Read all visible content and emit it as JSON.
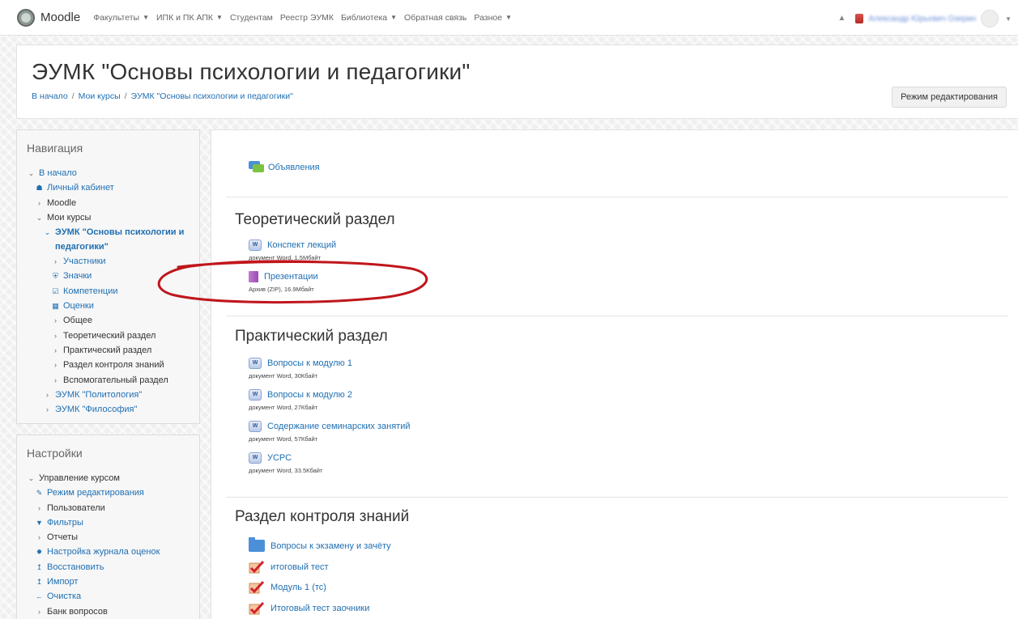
{
  "navbar": {
    "brand": "Moodle",
    "menu": [
      {
        "label": "Факультеты",
        "caret": true
      },
      {
        "label": "ИПК и ПК АПК",
        "caret": true
      },
      {
        "label": "Студентам",
        "caret": false
      },
      {
        "label": "Реестр ЭУМК",
        "caret": false
      },
      {
        "label": "Библиотека",
        "caret": true
      },
      {
        "label": "Обратная связь",
        "caret": false
      },
      {
        "label": "Разное",
        "caret": true
      }
    ],
    "username": "Александр Юрьевич Озерин"
  },
  "header": {
    "title": "ЭУМК \"Основы психологии и педагогики\"",
    "breadcrumb": [
      "В начало",
      "Мои курсы",
      "ЭУМК \"Основы психологии и педагогики\""
    ],
    "edit_button": "Режим редактирования"
  },
  "navigation": {
    "title": "Навигация",
    "items": [
      {
        "icon": "chevron-down-icon",
        "glyph": "⌄",
        "label": "В начало",
        "link": true
      },
      {
        "icon": "dashboard-icon",
        "glyph": "☗",
        "label": "Личный кабинет",
        "link": true
      },
      {
        "icon": "chevron-right-icon",
        "glyph": "›",
        "label": "Moodle",
        "link": false
      },
      {
        "icon": "chevron-down-icon",
        "glyph": "⌄",
        "label": "Мои курсы",
        "link": false
      },
      {
        "icon": "chevron-down-icon",
        "glyph": "⌄",
        "label": "ЭУМК \"Основы психологии и педагогики\"",
        "link": true,
        "bold": true
      },
      {
        "icon": "chevron-right-icon",
        "glyph": "›",
        "label": "Участники",
        "link": true
      },
      {
        "icon": "shield-icon",
        "glyph": "⛨",
        "label": "Значки",
        "link": true
      },
      {
        "icon": "checkbox-icon",
        "glyph": "☑",
        "label": "Компетенции",
        "link": true
      },
      {
        "icon": "table-icon",
        "glyph": "▦",
        "label": "Оценки",
        "link": true
      },
      {
        "icon": "chevron-right-icon",
        "glyph": "›",
        "label": "Общее",
        "link": false
      },
      {
        "icon": "chevron-right-icon",
        "glyph": "›",
        "label": "Теоретический раздел",
        "link": false
      },
      {
        "icon": "chevron-right-icon",
        "glyph": "›",
        "label": "Практический раздел",
        "link": false
      },
      {
        "icon": "chevron-right-icon",
        "glyph": "›",
        "label": "Раздел контроля знаний",
        "link": false
      },
      {
        "icon": "chevron-right-icon",
        "glyph": "›",
        "label": "Вспомогательный раздел",
        "link": false
      },
      {
        "icon": "chevron-right-icon",
        "glyph": "›",
        "label": "ЭУМК \"Политология\"",
        "link": true
      },
      {
        "icon": "chevron-right-icon",
        "glyph": "›",
        "label": "ЭУМК \"Философия\"",
        "link": true
      }
    ]
  },
  "settings": {
    "title": "Настройки",
    "items": [
      {
        "icon": "chevron-down-icon",
        "glyph": "⌄",
        "label": "Управление курсом",
        "link": false
      },
      {
        "icon": "pencil-icon",
        "glyph": "✎",
        "label": "Режим редактирования",
        "link": true
      },
      {
        "icon": "chevron-right-icon",
        "glyph": "›",
        "label": "Пользователи",
        "link": false
      },
      {
        "icon": "filter-icon",
        "glyph": "▼",
        "label": "Фильтры",
        "link": true
      },
      {
        "icon": "chevron-right-icon",
        "glyph": "›",
        "label": "Отчеты",
        "link": false
      },
      {
        "icon": "gear-icon",
        "glyph": "✹",
        "label": "Настройка журнала оценок",
        "link": true
      },
      {
        "icon": "upload-icon",
        "glyph": "↥",
        "label": "Восстановить",
        "link": true
      },
      {
        "icon": "upload-icon",
        "glyph": "↥",
        "label": "Импорт",
        "link": true
      },
      {
        "icon": "arrow-left-icon",
        "glyph": "←",
        "label": "Очистка",
        "link": true
      },
      {
        "icon": "chevron-right-icon",
        "glyph": "›",
        "label": "Банк вопросов",
        "link": false
      }
    ]
  },
  "main": {
    "announcements": "Объявления",
    "sections": [
      {
        "title": "Теоретический раздел",
        "activities": [
          {
            "icon": "word-icon",
            "label": "Конспект лекций",
            "meta": "документ Word, 1.5Мбайт"
          },
          {
            "icon": "zip-icon",
            "label": "Презентации",
            "meta": "Архив (ZIP), 16.9Мбайт"
          }
        ]
      },
      {
        "title": "Практический раздел",
        "activities": [
          {
            "icon": "word-icon",
            "label": "Вопросы к модулю 1",
            "meta": "документ Word, 30Кбайт"
          },
          {
            "icon": "word-icon",
            "label": "Вопросы к модулю 2",
            "meta": "документ Word, 27Кбайт"
          },
          {
            "icon": "word-icon",
            "label": "Содержание семинарских занятий",
            "meta": "документ Word, 57Кбайт"
          },
          {
            "icon": "word-icon",
            "label": "УСРС",
            "meta": "документ Word, 33.5Кбайт"
          }
        ]
      },
      {
        "title": "Раздел контроля знаний",
        "activities": [
          {
            "icon": "folder-icon",
            "label": "Вопросы к экзамену и зачёту"
          },
          {
            "icon": "quiz-icon",
            "label": "итоговый тест"
          },
          {
            "icon": "quiz-icon",
            "label": "Модуль 1 (тс)"
          },
          {
            "icon": "quiz-icon",
            "label": "Итоговый тест заочники"
          }
        ]
      }
    ]
  },
  "colors": {
    "link": "#1f6fb2",
    "highlight_ellipse": "#c0161c"
  }
}
